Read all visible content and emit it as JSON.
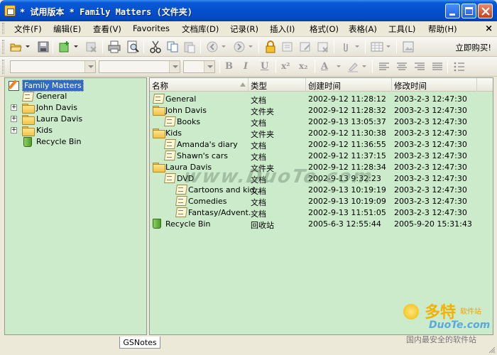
{
  "window": {
    "title": "* 试用版本 * Family Matters (文件夹)"
  },
  "menu": {
    "items": [
      "文件(F)",
      "编辑(E)",
      "查看(V)",
      "Favorites",
      "文档库(D)",
      "记录(R)",
      "插入(I)",
      "格式(O)",
      "表格(A)",
      "工具(L)",
      "帮助(H)"
    ],
    "close_label": "×"
  },
  "toolbar": {
    "buy_label": "立即购买!",
    "icons": [
      "open-folder-icon",
      "save-icon",
      "new-note-icon",
      "delete-icon",
      "print-icon",
      "print-preview-icon",
      "cut-icon",
      "copy-icon",
      "paste-icon",
      "back-icon",
      "forward-icon",
      "lock-icon",
      "add-record-icon",
      "edit-record-icon",
      "remove-record-icon",
      "attachment-icon",
      "table-icon",
      "insert-image-icon"
    ]
  },
  "format_toolbar": {
    "bold": "B",
    "italic": "I",
    "underline": "U",
    "superscript": "x²",
    "subscript": "x₂",
    "font_color": "A"
  },
  "tree": {
    "root": "Family Matters",
    "nodes": [
      {
        "label": "General",
        "icon": "document-icon",
        "expandable": false
      },
      {
        "label": "John Davis",
        "icon": "folder-icon",
        "expandable": true
      },
      {
        "label": "Laura Davis",
        "icon": "folder-icon",
        "expandable": true
      },
      {
        "label": "Kids",
        "icon": "folder-icon",
        "expandable": true
      },
      {
        "label": "Recycle Bin",
        "icon": "recycle-bin-icon",
        "expandable": false
      }
    ]
  },
  "list": {
    "columns": [
      "名称",
      "类型",
      "创建时间",
      "修改时间"
    ],
    "rows": [
      {
        "name": "General",
        "type": "文档",
        "created": "2002-9-12 11:28:12",
        "modified": "2003-2-3 12:47:30",
        "icon": "document-icon",
        "indent": 0
      },
      {
        "name": "John Davis",
        "type": "文件夹",
        "created": "2002-9-12 11:28:32",
        "modified": "2003-2-3 12:47:30",
        "icon": "folder-icon",
        "indent": 0
      },
      {
        "name": "Books",
        "type": "文档",
        "created": "2002-9-13 13:05:37",
        "modified": "2003-2-3 12:47:30",
        "icon": "document-icon",
        "indent": 1
      },
      {
        "name": "Kids",
        "type": "文件夹",
        "created": "2002-9-12 11:30:38",
        "modified": "2003-2-3 12:47:30",
        "icon": "folder-icon",
        "indent": 0
      },
      {
        "name": "Amanda's diary",
        "type": "文档",
        "created": "2002-9-12 11:36:55",
        "modified": "2003-2-3 12:47:30",
        "icon": "document-icon",
        "indent": 1
      },
      {
        "name": "Shawn's cars",
        "type": "文档",
        "created": "2002-9-12 11:37:15",
        "modified": "2003-2-3 12:47:30",
        "icon": "document-icon",
        "indent": 1
      },
      {
        "name": "Laura Davis",
        "type": "文件夹",
        "created": "2002-9-12 11:28:34",
        "modified": "2003-2-3 12:47:30",
        "icon": "folder-icon",
        "indent": 0
      },
      {
        "name": "DVD",
        "type": "文档",
        "created": "2002-9-13 9:32:23",
        "modified": "2003-2-3 12:47:30",
        "icon": "document-icon",
        "indent": 1
      },
      {
        "name": "Cartoons and kid...",
        "type": "文档",
        "created": "2002-9-13 10:19:19",
        "modified": "2003-2-3 12:47:30",
        "icon": "document-icon",
        "indent": 2
      },
      {
        "name": "Comedies",
        "type": "文档",
        "created": "2002-9-13 10:19:09",
        "modified": "2003-2-3 12:47:30",
        "icon": "document-icon",
        "indent": 2
      },
      {
        "name": "Fantasy/Advent...",
        "type": "文档",
        "created": "2002-9-13 11:51:05",
        "modified": "2003-2-3 12:47:30",
        "icon": "document-icon",
        "indent": 2
      },
      {
        "name": "Recycle Bin",
        "type": "回收站",
        "created": "2005-6-3 12:55:44",
        "modified": "2005-9-20 15:31:43",
        "icon": "recycle-bin-icon",
        "indent": 0
      }
    ]
  },
  "watermark": "www.DuoTe.com",
  "statusbar": {
    "tab_label": "GSNotes"
  },
  "site_logo": {
    "big": "多特",
    "small": "软件站",
    "url": "DuoTe.com",
    "tagline": "国内最安全的软件站"
  },
  "colors": {
    "pane_bg": "#cbebcb",
    "title_bar": "#0550d0",
    "chrome": "#ece9d8"
  }
}
